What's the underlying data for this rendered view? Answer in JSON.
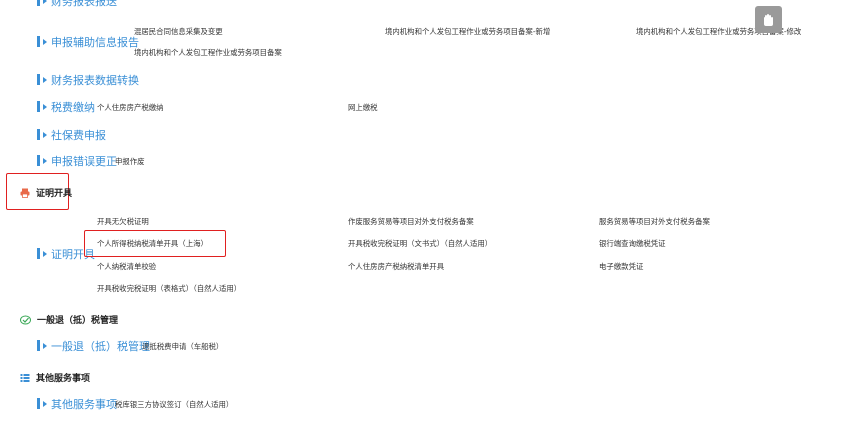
{
  "top_partial": {
    "label": "财务报表报送"
  },
  "rows": {
    "aux_info": {
      "label": "申报辅助信息报告",
      "items": [
        "混居民合同信息采集及变更",
        "境内机构和个人发包工程作业或劳务项目备案-新增",
        "境内机构和个人发包工程作业或劳务项目备案-修改",
        "境内机构和个人发包工程作业或劳务项目备案"
      ]
    },
    "fin_convert": {
      "label": "财务报表数据转换"
    },
    "tax_pay": {
      "label": "税费缴纳",
      "items": [
        "个人住房房产税缴纳",
        "网上缴税"
      ]
    },
    "social": {
      "label": "社保费申报"
    },
    "correction": {
      "label": "申报错误更正",
      "items": [
        "申报作废"
      ]
    }
  },
  "sections": {
    "cert": {
      "title": "证明开具",
      "icon": "printer-icon"
    },
    "refund": {
      "title": "一般退（抵）税管理",
      "icon": "refund-check-icon"
    },
    "other": {
      "title": "其他服务事项",
      "icon": "list-icon"
    }
  },
  "cert_row": {
    "label": "证明开具",
    "items": [
      "开具无欠税证明",
      "作废服务贸易等项目对外支付税务备案",
      "服务贸易等项目对外支付税务备案",
      "个人所得税纳税清单开具（上海）",
      "开具税收完税证明（文书式）（自然人适用）",
      "银行端查询缴税凭证",
      "个人纳税清单校验",
      "个人住房房产税纳税清单开具",
      "电子缴款凭证",
      "开具税收完税证明（表格式）（自然人适用）"
    ]
  },
  "refund_row": {
    "label": "一般退（抵）税管理",
    "items": [
      "退抵税费申请（车船税）"
    ]
  },
  "other_row": {
    "label": "其他服务事项",
    "items": [
      "税库银三方协议签订（自然人适用）"
    ]
  },
  "colors": {
    "accent": "#3a8fd6",
    "highlight": "#e02020",
    "section_icon": "#e86a4a"
  }
}
